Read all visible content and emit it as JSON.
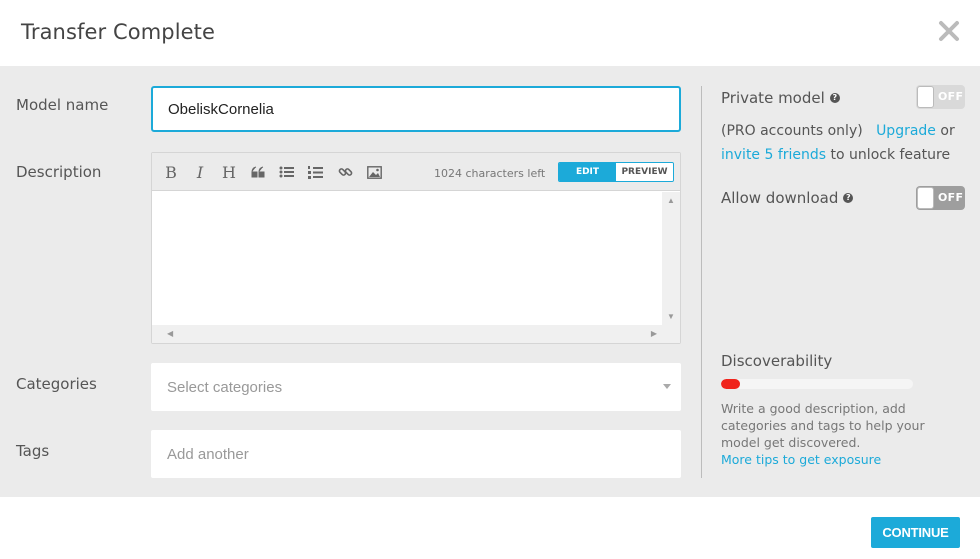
{
  "dialog": {
    "title": "Transfer Complete"
  },
  "form": {
    "model_name_label": "Model name",
    "model_name_value": "ObeliskCornelia",
    "description_label": "Description",
    "chars_left": "1024 characters left",
    "edit_label": "EDIT",
    "preview_label": "PREVIEW",
    "categories_label": "Categories",
    "categories_placeholder": "Select categories",
    "tags_label": "Tags",
    "tags_placeholder": "Add another",
    "toolbar_icons": [
      "bold-icon",
      "italic-icon",
      "heading-icon",
      "quote-icon",
      "bullet-list-icon",
      "numbered-list-icon",
      "link-icon",
      "image-icon"
    ]
  },
  "sidebar": {
    "private_label": "Private model",
    "private_toggle": "OFF",
    "pro_text": "(PRO accounts only)",
    "upgrade_link": "Upgrade",
    "or_text": "or",
    "invite_link": "invite 5 friends",
    "unlock_text": "to unlock feature",
    "download_label": "Allow download",
    "download_toggle": "OFF",
    "discoverability_label": "Discoverability",
    "discoverability_level": 0.1,
    "discover_text": "Write a good description, add categories and tags to help your model get discovered.",
    "tips_link": "More tips to get exposure"
  },
  "footer": {
    "continue_label": "CONTINUE"
  },
  "colors": {
    "accent": "#1caad9",
    "danger": "#f0241c",
    "panel_bg": "#ebebeb"
  }
}
